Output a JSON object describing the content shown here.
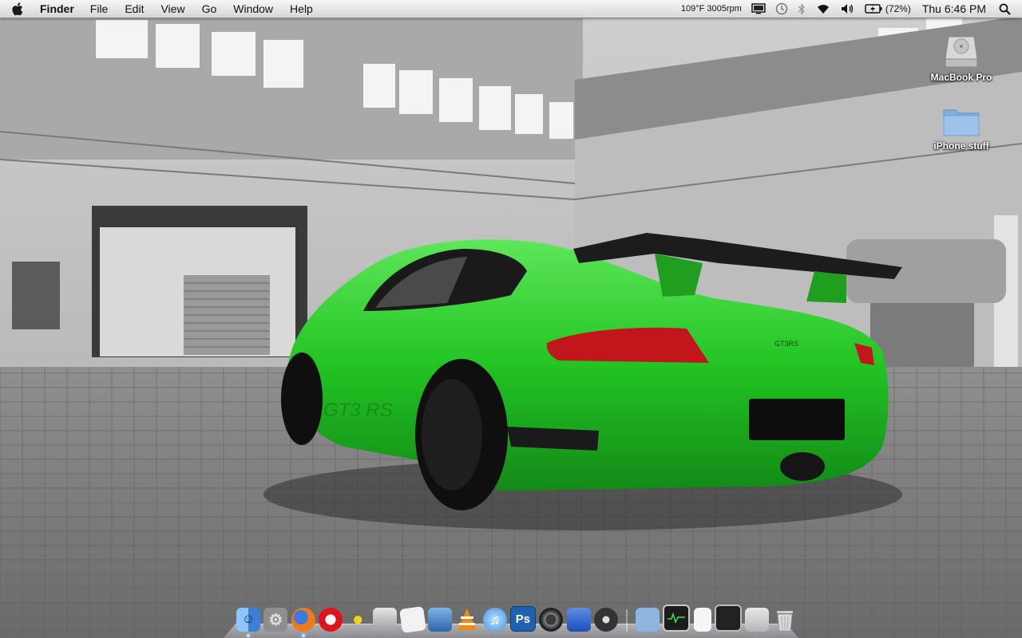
{
  "menubar": {
    "app_name": "Finder",
    "menus": [
      "File",
      "Edit",
      "View",
      "Go",
      "Window",
      "Help"
    ],
    "status_text": "109°F 3005rpm",
    "battery_percent": "(72%)",
    "clock": "Thu 6:46 PM"
  },
  "desktop": {
    "icons": [
      {
        "label": "MacBook Pro",
        "icon": "hard-drive-icon"
      },
      {
        "label": "iPhone stuff",
        "icon": "folder-icon"
      }
    ]
  },
  "wallpaper": {
    "car_badge": "GT3RS",
    "car_side_text": "GT3 RS",
    "accent_color": "#22c423"
  },
  "dock": {
    "items": [
      {
        "name": "finder",
        "running": true
      },
      {
        "name": "system-preferences",
        "running": false
      },
      {
        "name": "firefox",
        "running": true
      },
      {
        "name": "opera",
        "running": false
      },
      {
        "name": "cyberduck",
        "running": false
      },
      {
        "name": "calculator",
        "running": false
      },
      {
        "name": "textedit",
        "running": false
      },
      {
        "name": "preview",
        "running": false
      },
      {
        "name": "vlc",
        "running": false
      },
      {
        "name": "itunes",
        "running": false
      },
      {
        "name": "photoshop",
        "label": "Ps",
        "running": false
      },
      {
        "name": "camera",
        "running": false
      },
      {
        "name": "xcode-instruments",
        "running": false
      },
      {
        "name": "dvd-player",
        "running": false
      },
      {
        "name": "applications-folder",
        "running": false
      },
      {
        "name": "activity-monitor",
        "running": false
      },
      {
        "name": "documents-stack",
        "running": false
      },
      {
        "name": "terminal",
        "running": false
      },
      {
        "name": "downloads-stack",
        "running": false
      },
      {
        "name": "trash",
        "running": false
      }
    ]
  }
}
